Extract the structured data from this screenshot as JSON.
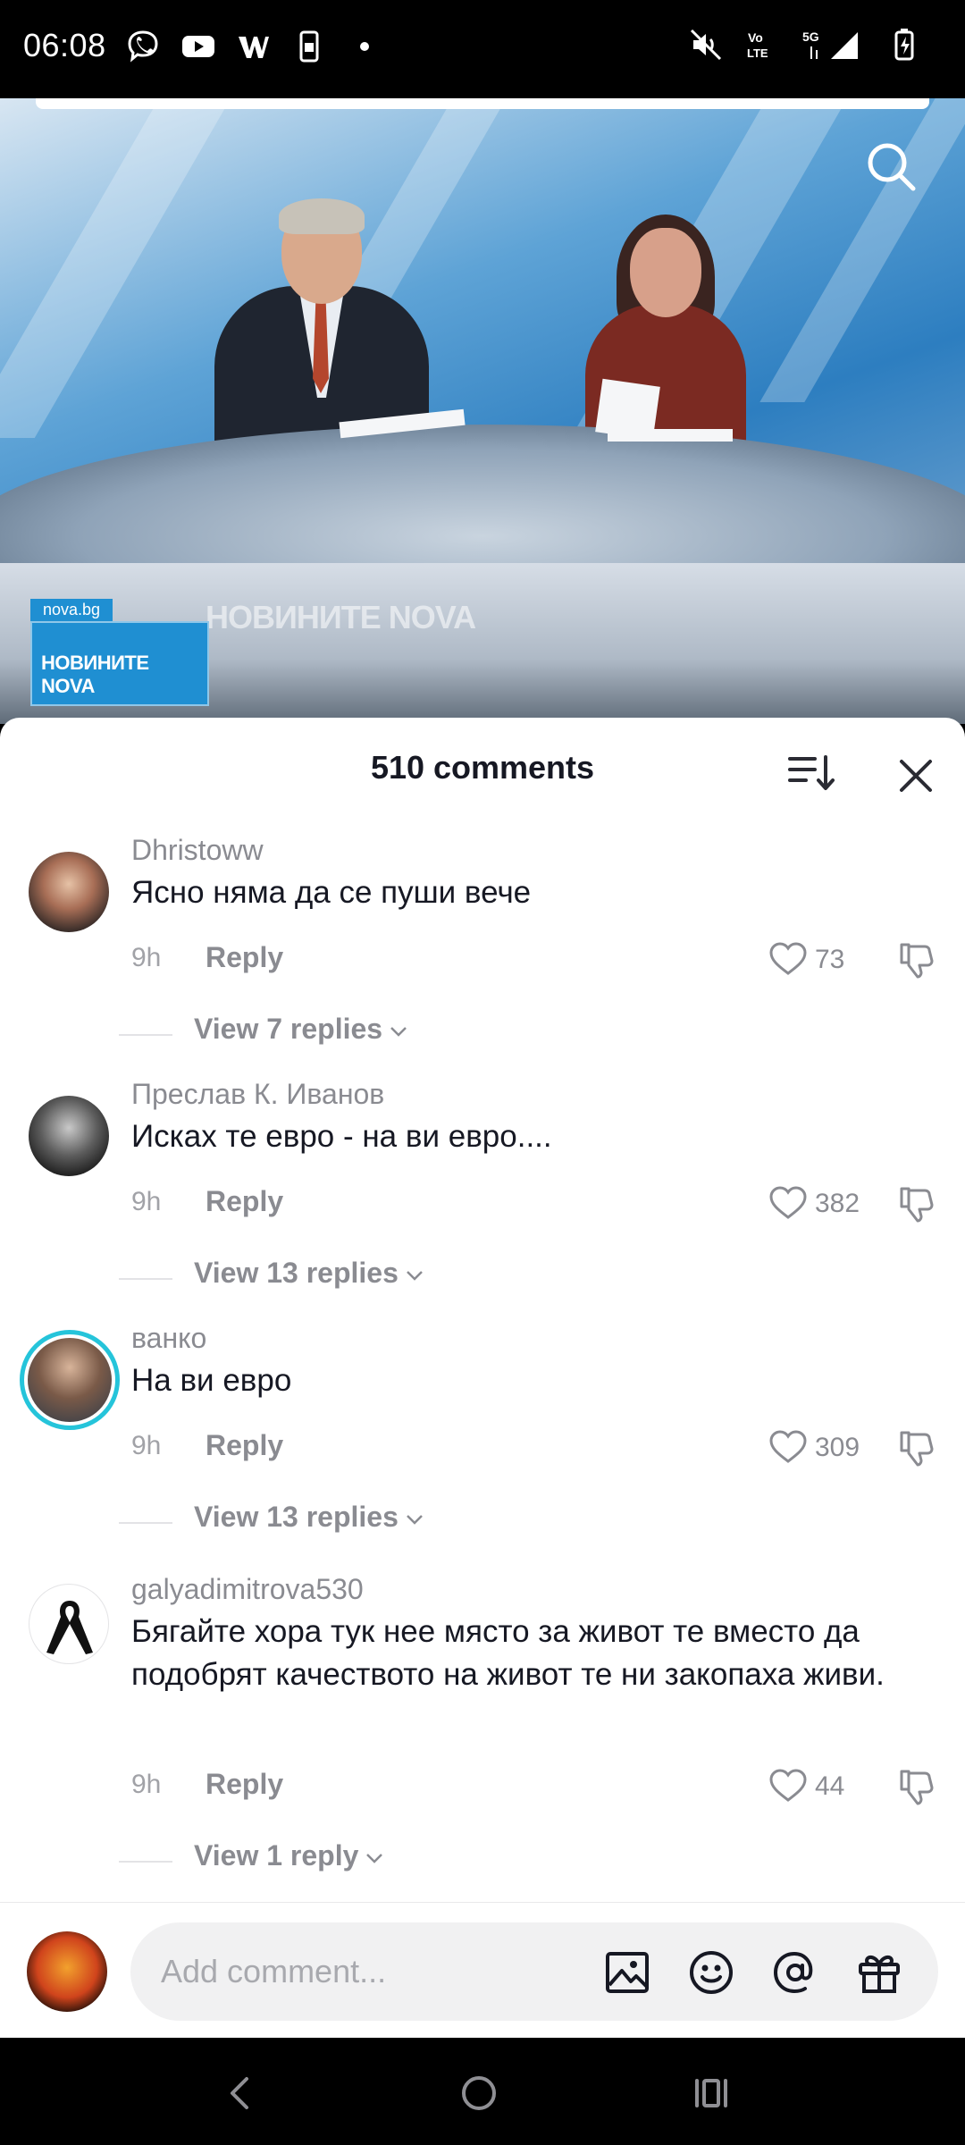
{
  "status_bar": {
    "time": "06:08",
    "left_icons": [
      "viber-icon",
      "youtube-icon",
      "w-app-icon",
      "phone-storage-icon",
      "dot-icon"
    ],
    "right_icons": [
      "mute-icon",
      "volte-icon",
      "5g-signal-icon",
      "battery-charging-icon"
    ],
    "network_labels": {
      "volte": "Vo LTE",
      "gen": "5G"
    }
  },
  "video": {
    "channel_small": "nova.bg",
    "channel_logo": "НОВИНИТЕ NOVA",
    "channel_wall": "НОВИНИТЕ NOVA"
  },
  "comments_sheet": {
    "title": "510 comments",
    "comments": [
      {
        "user": "Dhristoww",
        "text": "Ясно няма да се пуши вече",
        "time": "9h",
        "reply_label": "Reply",
        "likes": "73",
        "view_replies": "View 7 replies"
      },
      {
        "user": "Преслав К. Иванов",
        "text": "Исках те евро - на ви евро....",
        "time": "9h",
        "reply_label": "Reply",
        "likes": "382",
        "view_replies": "View 13 replies"
      },
      {
        "user": "ванко",
        "text": "На ви евро",
        "time": "9h",
        "reply_label": "Reply",
        "likes": "309",
        "view_replies": "View 13 replies"
      },
      {
        "user": "galyadimitrova530",
        "text": "Бягайте хора тук нее място за живот те вместо да подобрят качеството на живот те ни закопаха живи.",
        "time": "9h",
        "reply_label": "Reply",
        "likes": "44",
        "view_replies": "View 1 reply"
      }
    ]
  },
  "input_bar": {
    "placeholder": "Add comment...",
    "icons": [
      "image-icon",
      "emoji-icon",
      "mention-icon",
      "gift-icon"
    ]
  },
  "colors": {
    "accent_ring": "#25c4da",
    "text_primary": "#161823",
    "text_secondary": "#8a8b91"
  }
}
